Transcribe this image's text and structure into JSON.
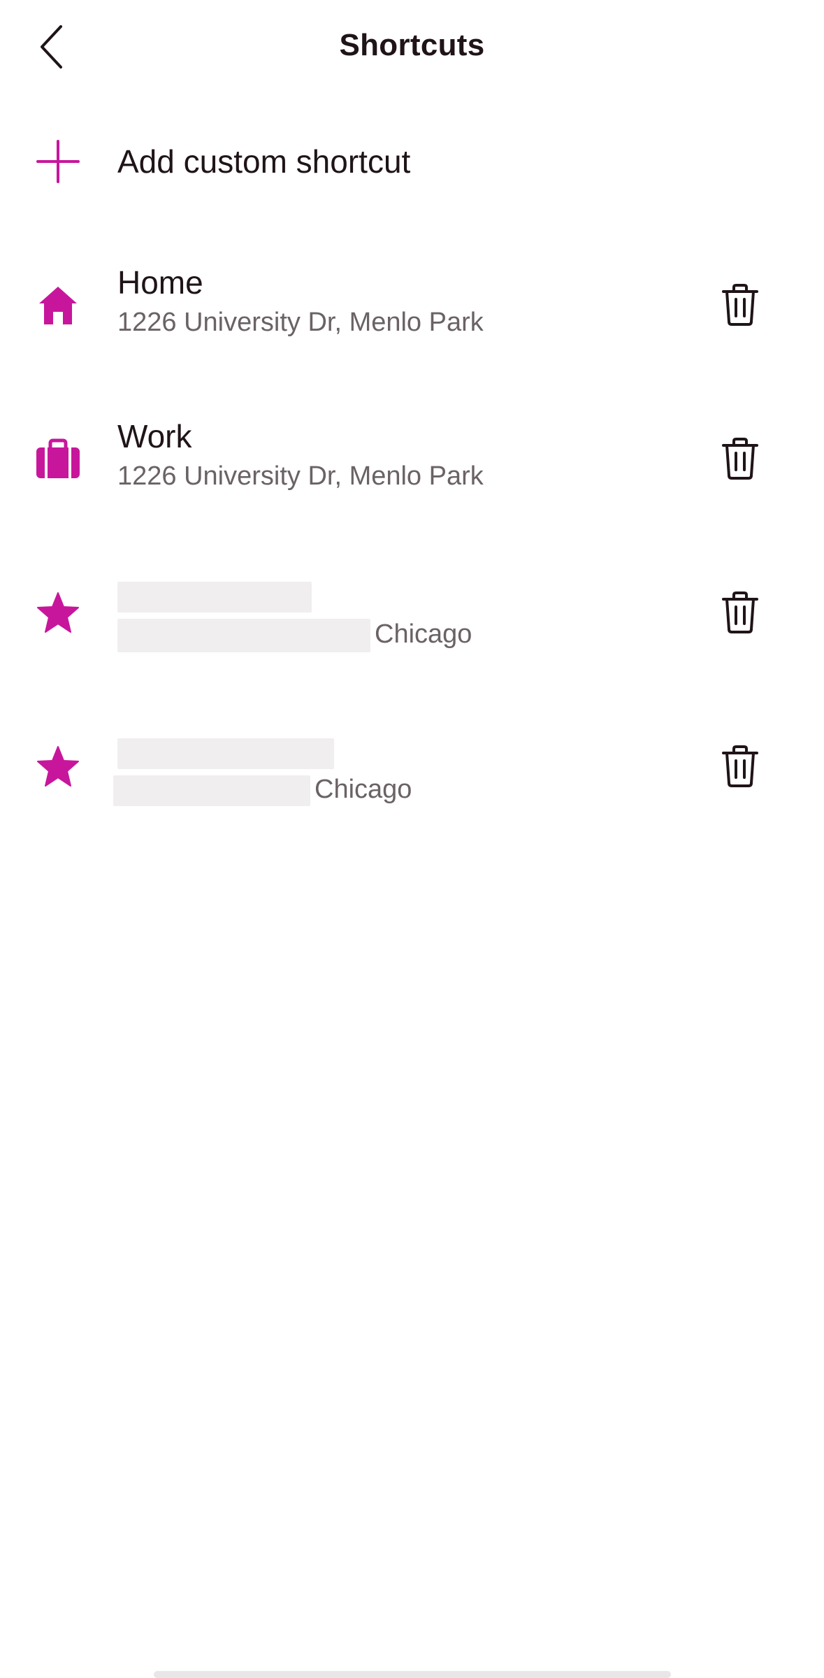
{
  "header": {
    "title": "Shortcuts"
  },
  "add_shortcut": {
    "label": "Add custom shortcut"
  },
  "shortcuts": [
    {
      "icon": "home-icon",
      "title": "Home",
      "subtitle": "1226 University Dr, Menlo Park"
    },
    {
      "icon": "briefcase-icon",
      "title": "Work",
      "subtitle": "1226 University Dr, Menlo Park"
    },
    {
      "icon": "star-icon",
      "title": "",
      "subtitle": "Chicago"
    },
    {
      "icon": "star-icon",
      "title": "",
      "subtitle": "Chicago"
    }
  ],
  "colors": {
    "accent": "#c8169c",
    "text": "#1f1418",
    "secondary_text": "#6a6266"
  }
}
